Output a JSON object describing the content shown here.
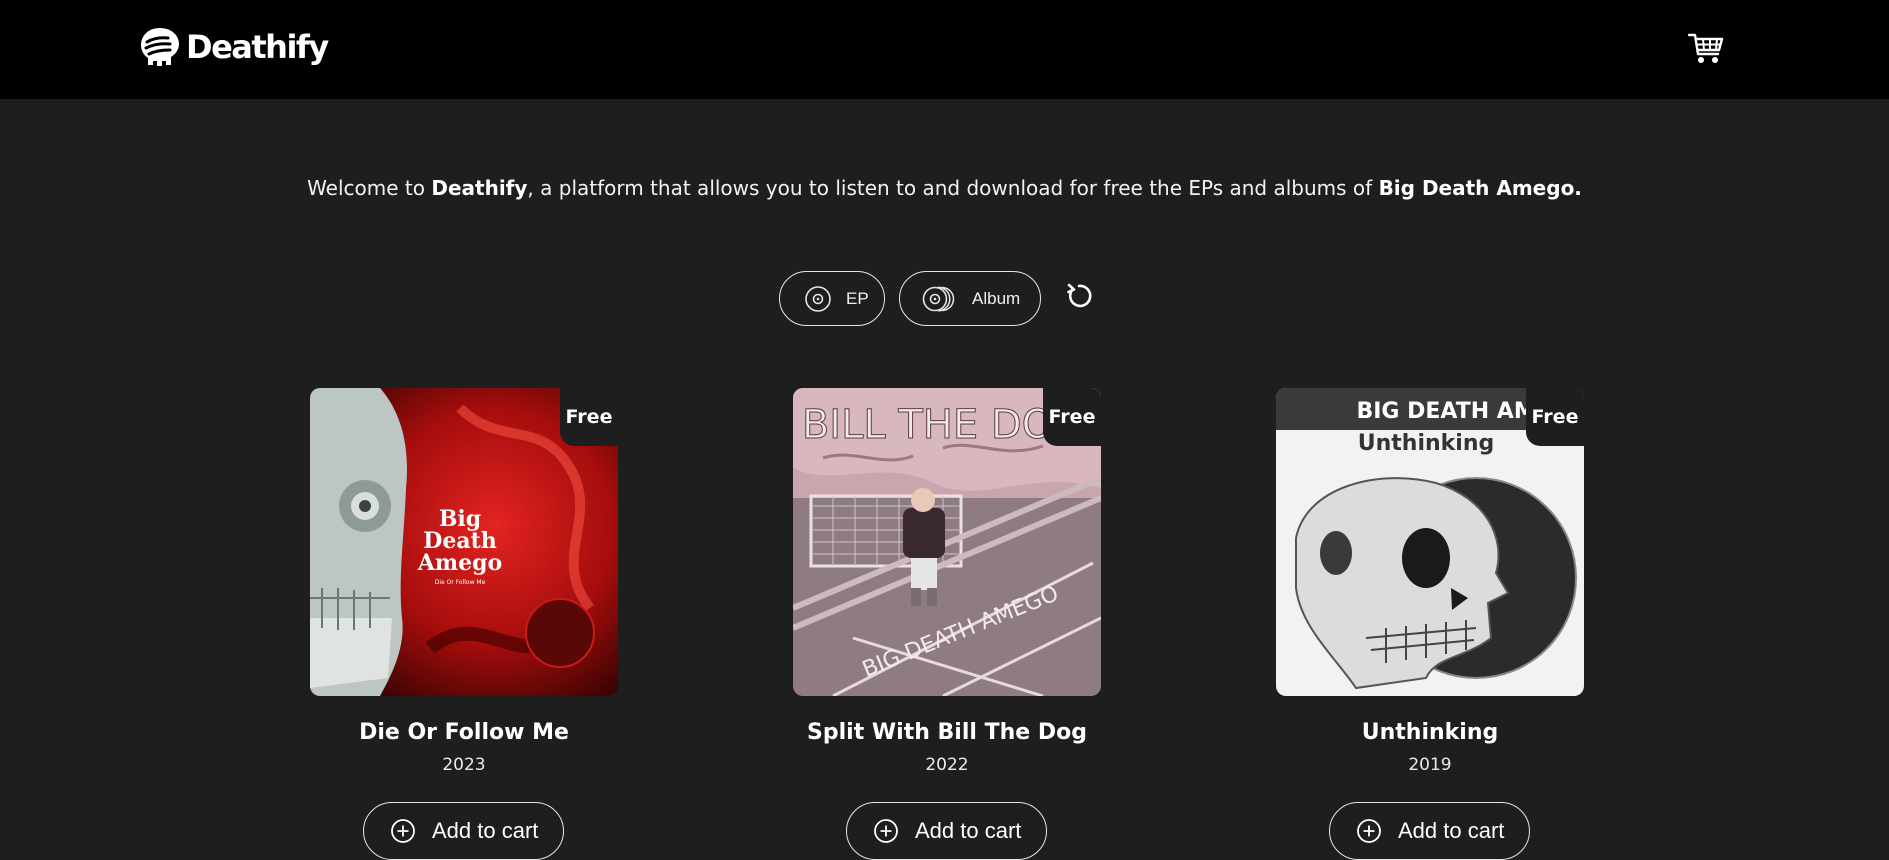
{
  "brand": {
    "name": "Deathify"
  },
  "header": {
    "cart_icon": "shopping-cart-icon"
  },
  "welcome": {
    "prefix": "Welcome to ",
    "brand": "Deathify",
    "middle": ", a platform that allows you to listen to and download for free the EPs and albums of ",
    "artist": "Big Death Amego."
  },
  "filters": {
    "ep_label": "EP",
    "album_label": "Album",
    "reset_icon": "reset-icon"
  },
  "releases": [
    {
      "title": "Die Or Follow Me",
      "year": "2023",
      "price": "Free",
      "cart_label": "Add to cart",
      "cover_text": [
        "Big",
        "Death",
        "Amego",
        "Die Or Follow Me"
      ]
    },
    {
      "title": "Split With Bill The Dog",
      "year": "2022",
      "price": "Free",
      "cart_label": "Add to cart",
      "cover_text": [
        "BILL THE DOG",
        "BIG DEATH AMEGO"
      ]
    },
    {
      "title": "Unthinking",
      "year": "2019",
      "price": "Free",
      "cart_label": "Add to cart",
      "cover_text": [
        "BIG DEATH AMEGO",
        "Unthinking"
      ]
    }
  ],
  "colors": {
    "background": "#1e1e1e",
    "header": "#000000",
    "text": "#ffffff"
  }
}
